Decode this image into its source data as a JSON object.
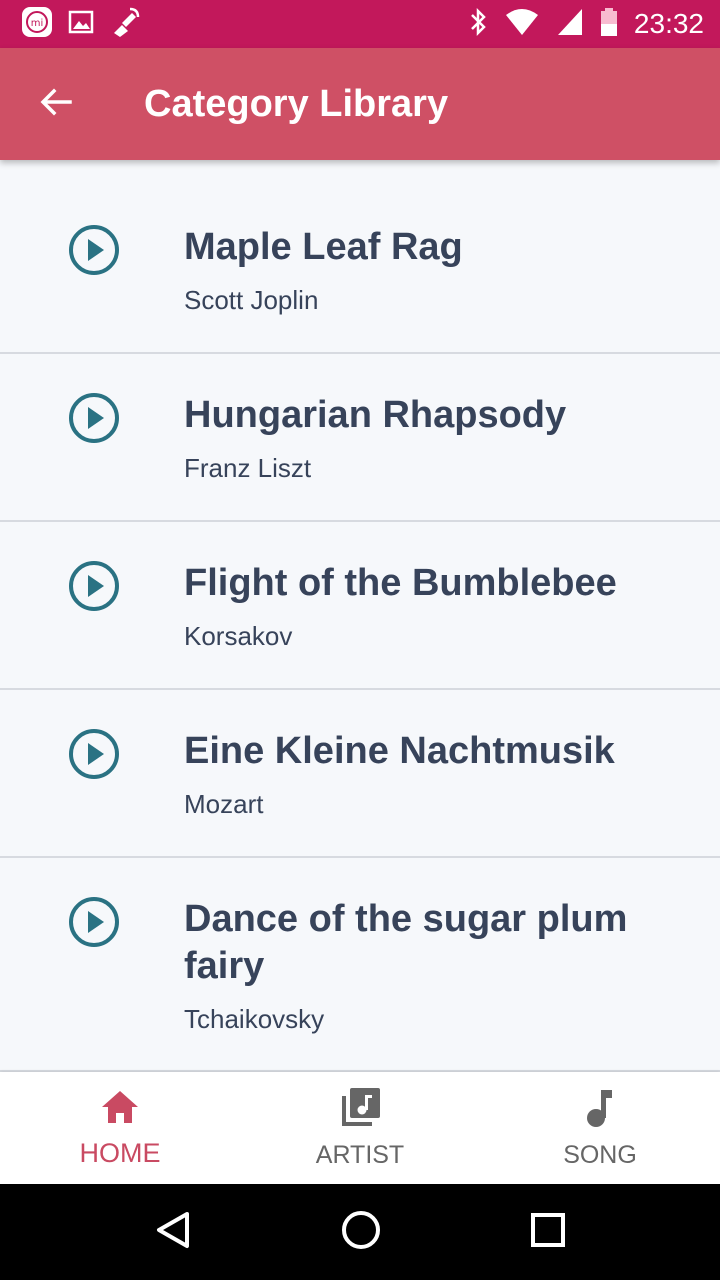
{
  "status_bar": {
    "time": "23:32",
    "left_icons": [
      "mi-icon",
      "image-icon",
      "satellite-icon"
    ],
    "right_icons": [
      "bluetooth-icon",
      "wifi-icon",
      "signal-icon",
      "battery-icon"
    ]
  },
  "app_bar": {
    "title": "Category Library"
  },
  "songs": [
    {
      "title": "Maple Leaf Rag",
      "artist": "Scott Joplin"
    },
    {
      "title": "Hungarian Rhapsody",
      "artist": "Franz Liszt"
    },
    {
      "title": "Flight of the Bumblebee",
      "artist": "Korsakov"
    },
    {
      "title": "Eine Kleine Nachtmusik",
      "artist": "Mozart"
    },
    {
      "title": "Dance of the sugar plum fairy",
      "artist": "Tchaikovsky"
    }
  ],
  "bottom_nav": {
    "items": [
      {
        "label": "HOME",
        "icon": "home-icon",
        "active": true
      },
      {
        "label": "ARTIST",
        "icon": "music-library-icon",
        "active": false
      },
      {
        "label": "SONG",
        "icon": "music-note-icon",
        "active": false
      }
    ]
  },
  "colors": {
    "status_bar": "#c2185b",
    "app_bar": "#cf5065",
    "play_icon": "#2a7283",
    "active_nav": "#c94a62"
  }
}
